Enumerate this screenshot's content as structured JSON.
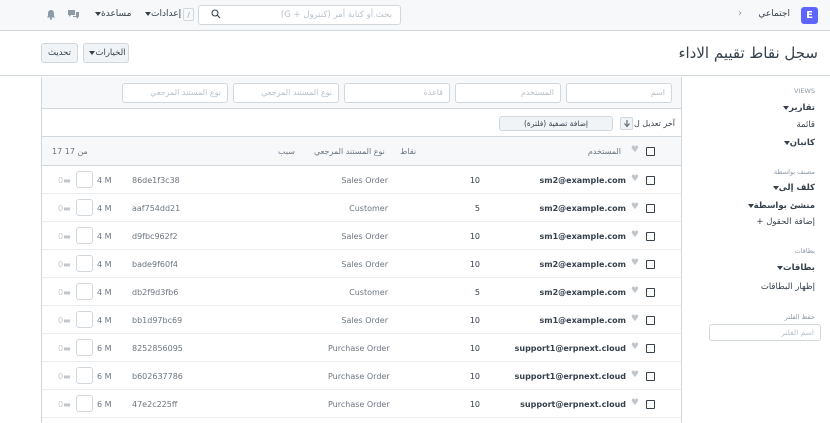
{
  "navbar": {
    "logo": "E",
    "breadcrumb": "اجتماعي",
    "search_placeholder": "بحث أو كتابة أمر (كنترول + G)",
    "kbd": "/",
    "settings": "إعدادات",
    "help": "مساعدة"
  },
  "page": {
    "title": "سجل نقاط تقييم الاداء",
    "options_button": "الخيارات",
    "refresh_button": "تحديث"
  },
  "sidebar": {
    "views_label": "VIEWS",
    "reports": "تقارير",
    "list": "قائمة",
    "kanban": "كانبان",
    "assigned_label": "مصنف بواسطة",
    "assigned_to": "كلف إلى",
    "created_by": "منشئ بواسطة",
    "add_fields": "إضافة الحقول",
    "tags_label": "بطاقات",
    "tags": "بطاقات",
    "show_tags": "إظهار البطاقات",
    "save_filter_label": "حفظ الفلتر",
    "filter_name_placeholder": "اسم الفلتر"
  },
  "filters": {
    "name": "اسم",
    "user": "المستخدم",
    "rule": "قاعدة",
    "ref_doctype": "نوع المستند المرجعي"
  },
  "sort": {
    "label": "آخر تعديل ل",
    "add_filter": "إضافة تصفية (فلترة)"
  },
  "columns": {
    "user": "المستخدم",
    "points": "نقاط",
    "ref_doctype": "نوع المستند المرجعي",
    "reason": "سبب",
    "count": "17 من 17"
  },
  "rows": [
    {
      "user": "sm2@example.com",
      "points": "10",
      "doctype": "Sales Order",
      "id": "86de1f3c38",
      "age": "4 M",
      "comments": "0"
    },
    {
      "user": "sm2@example.com",
      "points": "5",
      "doctype": "Customer",
      "id": "aaf754dd21",
      "age": "4 M",
      "comments": "0"
    },
    {
      "user": "sm1@example.com",
      "points": "10",
      "doctype": "Sales Order",
      "id": "d9fbc962f2",
      "age": "4 M",
      "comments": "0"
    },
    {
      "user": "sm2@example.com",
      "points": "10",
      "doctype": "Sales Order",
      "id": "bade9f60f4",
      "age": "4 M",
      "comments": "0"
    },
    {
      "user": "sm2@example.com",
      "points": "5",
      "doctype": "Customer",
      "id": "db2f9d3fb6",
      "age": "4 M",
      "comments": "0"
    },
    {
      "user": "sm1@example.com",
      "points": "10",
      "doctype": "Sales Order",
      "id": "bb1d97bc69",
      "age": "4 M",
      "comments": "0"
    },
    {
      "user": "support1@erpnext.cloud",
      "points": "10",
      "doctype": "Purchase Order",
      "id": "8252856095",
      "age": "6 M",
      "comments": "0"
    },
    {
      "user": "support1@erpnext.cloud",
      "points": "10",
      "doctype": "Purchase Order",
      "id": "b602637786",
      "age": "6 M",
      "comments": "0"
    },
    {
      "user": "support@erpnext.cloud",
      "points": "10",
      "doctype": "Purchase Order",
      "id": "47e2c225ff",
      "age": "6 M",
      "comments": "0"
    }
  ]
}
